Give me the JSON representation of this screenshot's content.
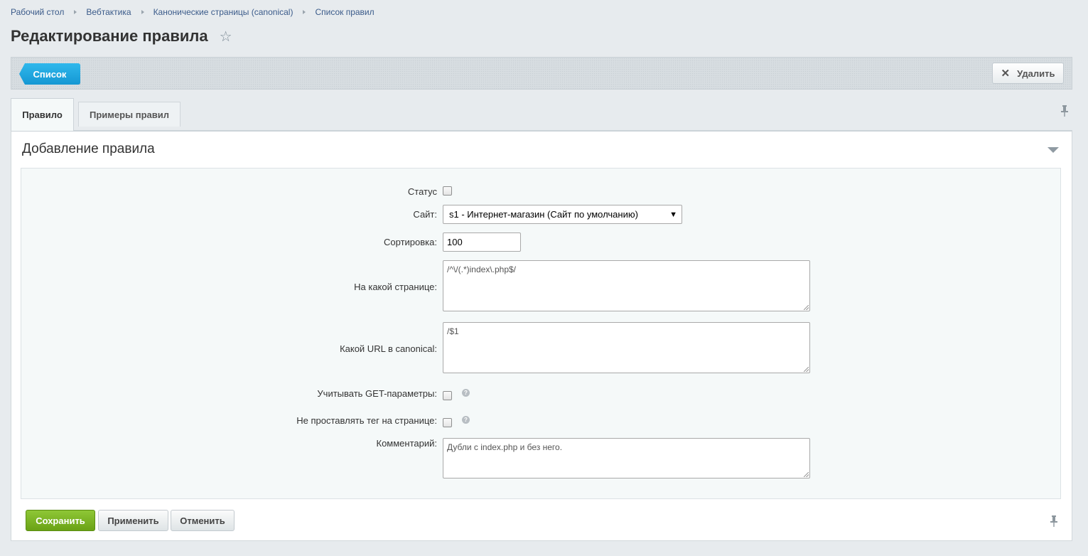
{
  "breadcrumb": [
    "Рабочий стол",
    "Вебтактика",
    "Канонические страницы (canonical)",
    "Список правил"
  ],
  "page_title": "Редактирование правила",
  "toolbar": {
    "list_label": "Список",
    "delete_label": "Удалить"
  },
  "tabs": [
    {
      "label": "Правило",
      "active": true
    },
    {
      "label": "Примеры правил",
      "active": false
    }
  ],
  "section_title": "Добавление правила",
  "form": {
    "status_label": "Статус",
    "status_checked": false,
    "site_label": "Сайт:",
    "site_value": "s1 - Интернет-магазин (Сайт по умолчанию)",
    "sort_label": "Сортировка:",
    "sort_value": "100",
    "page_label": "На какой странице:",
    "page_value": "/^\\/(.*)index\\.php$/",
    "canonical_label": "Какой URL в canonical:",
    "canonical_value": "/$1",
    "get_params_label": "Учитывать GET-параметры:",
    "get_params_checked": false,
    "no_tag_label": "Не проставлять тег на странице:",
    "no_tag_checked": false,
    "comment_label": "Комментарий:",
    "comment_value": "Дубли с index.php и без него."
  },
  "buttons": {
    "save": "Сохранить",
    "apply": "Применить",
    "cancel": "Отменить"
  },
  "icons": {
    "star": "star-icon",
    "close": "close-icon",
    "pin": "pin-icon",
    "help": "help-icon",
    "collapse": "chevron-down-icon"
  },
  "colors": {
    "accent_blue": "#1fa6e0",
    "save_green": "#7ab526",
    "background": "#e7ebee"
  }
}
